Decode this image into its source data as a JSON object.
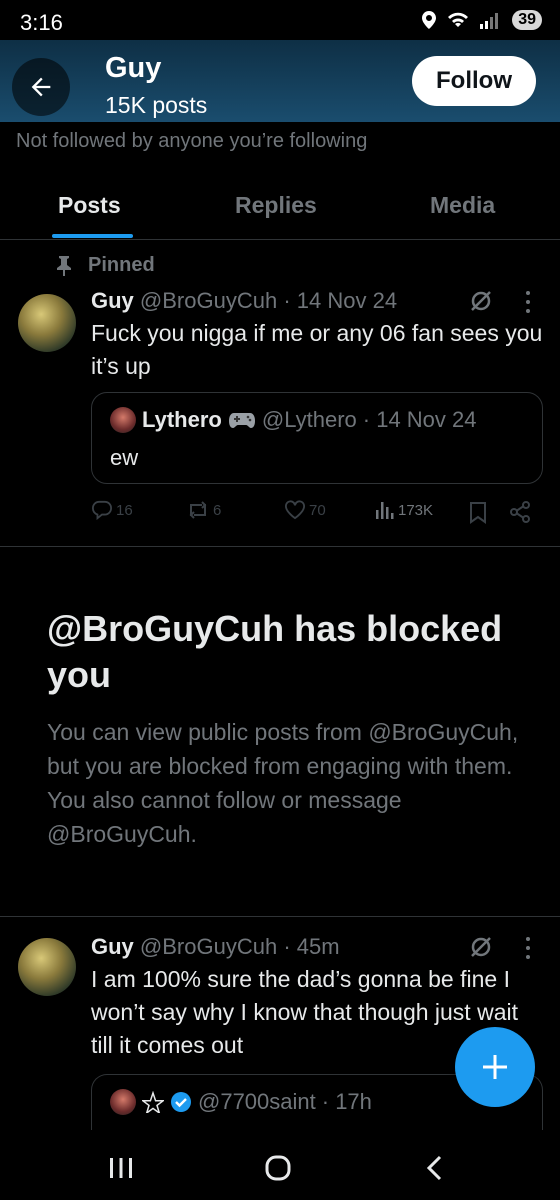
{
  "status_bar": {
    "time": "3:16",
    "battery": "39"
  },
  "header": {
    "name": "Guy",
    "post_count": "15K posts",
    "follow_label": "Follow"
  },
  "followed_note": "Not followed by anyone you’re following",
  "tabs": [
    {
      "label": "Posts",
      "active": true
    },
    {
      "label": "Replies",
      "active": false
    },
    {
      "label": "Media",
      "active": false
    }
  ],
  "pinned_tweet": {
    "pinned_label": "Pinned",
    "name": "Guy",
    "handle": "@BroGuyCuh",
    "time": "· 14 Nov 24",
    "text": "Fuck you nigga if me or any 06 fan sees you it’s up",
    "quote": {
      "name": "Lythero",
      "handle": "@Lythero",
      "time": "· 14 Nov 24",
      "text": "ew"
    },
    "stats": {
      "replies": "16",
      "reposts": "6",
      "likes": "70",
      "views": "173K"
    }
  },
  "blocked": {
    "title": "@BroGuyCuh has blocked you",
    "body": "You can view public posts from @BroGuyCuh, but you are blocked from engaging with them. You also cannot follow or message @BroGuyCuh."
  },
  "second_tweet": {
    "name": "Guy",
    "handle": "@BroGuyCuh",
    "time": "· 45m",
    "text": "I am 100% sure the dad’s gonna be fine I won’t say why I know that though just wait till it comes out",
    "quote": {
      "handle": "@7700saint",
      "time": "· 17h"
    }
  },
  "colors": {
    "accent": "#1d9bf0",
    "background": "#000000",
    "muted": "#71767b",
    "header": "#1a4d6e"
  }
}
